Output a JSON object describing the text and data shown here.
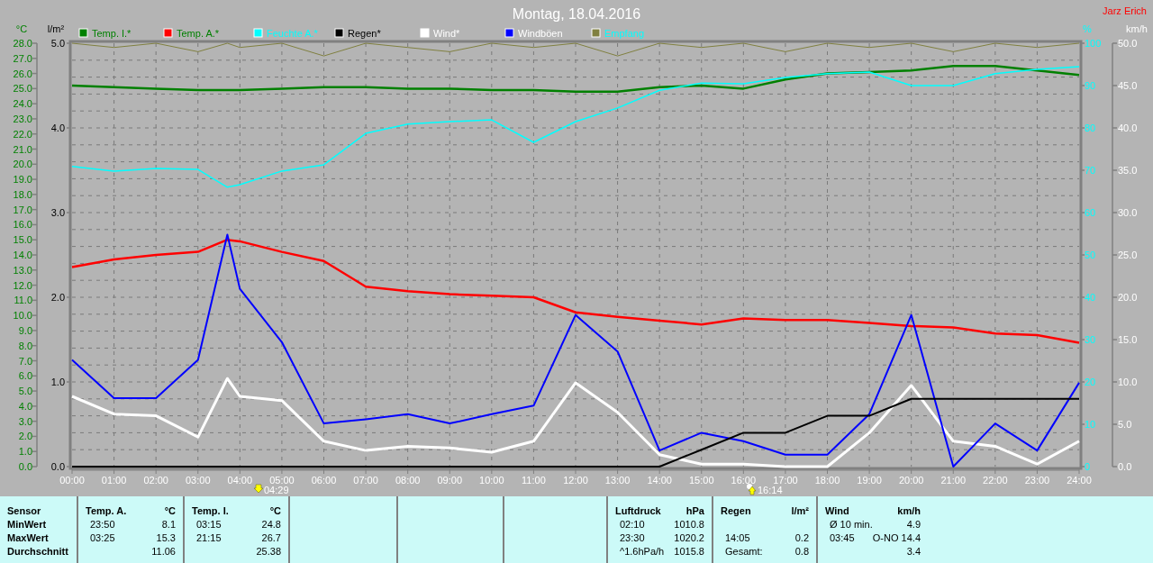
{
  "title": "Montag, 18.04.2016",
  "author": "Jarz Erich",
  "chart": {
    "chart_data": {
      "type": "line",
      "grid": true,
      "legend": "top",
      "ylabel": "°C",
      "y2label": "%",
      "y3label": "km/h",
      "x": [
        0,
        1,
        2,
        3,
        3.7,
        4,
        5,
        6,
        7,
        8,
        9,
        10,
        11,
        12,
        13,
        14,
        15,
        16,
        17,
        18,
        19,
        20,
        21,
        22,
        23,
        24
      ],
      "xlim": [
        0,
        24
      ],
      "xticks": [
        {
          "value": 0,
          "label": "00:00"
        },
        {
          "value": 1,
          "label": "01:00"
        },
        {
          "value": 2,
          "label": "02:00"
        },
        {
          "value": 3,
          "label": "03:00"
        },
        {
          "value": 4,
          "label": "04:00"
        },
        {
          "value": 5,
          "label": "05:00"
        },
        {
          "value": 6,
          "label": "06:00"
        },
        {
          "value": 7,
          "label": "07:00"
        },
        {
          "value": 8,
          "label": "08:00"
        },
        {
          "value": 9,
          "label": "09:00"
        },
        {
          "value": 10,
          "label": "10:00"
        },
        {
          "value": 11,
          "label": "11:00"
        },
        {
          "value": 12,
          "label": "12:00"
        },
        {
          "value": 13,
          "label": "13:00"
        },
        {
          "value": 14,
          "label": "14:00"
        },
        {
          "value": 15,
          "label": "15:00"
        },
        {
          "value": 16,
          "label": "16:00"
        },
        {
          "value": 17,
          "label": "17:00"
        },
        {
          "value": 18,
          "label": "18:00"
        },
        {
          "value": 19,
          "label": "19:00"
        },
        {
          "value": 20,
          "label": "20:00"
        },
        {
          "value": 21,
          "label": "21:00"
        },
        {
          "value": 22,
          "label": "22:00"
        },
        {
          "value": 23,
          "label": "23:00"
        },
        {
          "value": 24,
          "label": "24:00"
        }
      ],
      "ylim": [
        0,
        28
      ],
      "yticks": [
        {
          "value": 28,
          "label": "28.0"
        },
        {
          "value": 27,
          "label": "27.0"
        },
        {
          "value": 26,
          "label": "26.0"
        },
        {
          "value": 25,
          "label": "25.0"
        },
        {
          "value": 24,
          "label": "24.0"
        },
        {
          "value": 23,
          "label": "23.0"
        },
        {
          "value": 22,
          "label": "22.0"
        },
        {
          "value": 21,
          "label": "21.0"
        },
        {
          "value": 20,
          "label": "20.0"
        },
        {
          "value": 19,
          "label": "19.0"
        },
        {
          "value": 18,
          "label": "18.0"
        },
        {
          "value": 17,
          "label": "17.0"
        },
        {
          "value": 16,
          "label": "16.0"
        },
        {
          "value": 15,
          "label": "15.0"
        },
        {
          "value": 14,
          "label": "14.0"
        },
        {
          "value": 13,
          "label": "13.0"
        },
        {
          "value": 12,
          "label": "12.0"
        },
        {
          "value": 11,
          "label": "11.0"
        },
        {
          "value": 10,
          "label": "10.0"
        },
        {
          "value": 9,
          "label": "9.0"
        },
        {
          "value": 8,
          "label": "8.0"
        },
        {
          "value": 7,
          "label": "7.0"
        },
        {
          "value": 6,
          "label": "6.0"
        },
        {
          "value": 5,
          "label": "5.0"
        },
        {
          "value": 4,
          "label": "4.0"
        },
        {
          "value": 3,
          "label": "3.0"
        },
        {
          "value": 2,
          "label": "2.0"
        },
        {
          "value": 1,
          "label": "1.0"
        },
        {
          "value": 0,
          "label": "0.0"
        }
      ],
      "y2lim": [
        0,
        100
      ],
      "y2ticks": [
        {
          "value": 100,
          "label": "100"
        },
        {
          "value": 90,
          "label": "90"
        },
        {
          "value": 80,
          "label": "80"
        },
        {
          "value": 70,
          "label": "70"
        },
        {
          "value": 60,
          "label": "60"
        },
        {
          "value": 50,
          "label": "50"
        },
        {
          "value": 40,
          "label": "40"
        },
        {
          "value": 30,
          "label": "30"
        },
        {
          "value": 20,
          "label": "20"
        },
        {
          "value": 10,
          "label": "10"
        },
        {
          "value": 0,
          "label": "0"
        }
      ],
      "y3lim": [
        0,
        50
      ],
      "y3ticks": [
        {
          "value": 50,
          "label": "50.0"
        },
        {
          "value": 45,
          "label": "45.0"
        },
        {
          "value": 40,
          "label": "40.0"
        },
        {
          "value": 35,
          "label": "35.0"
        },
        {
          "value": 30,
          "label": "30.0"
        },
        {
          "value": 25,
          "label": "25.0"
        },
        {
          "value": 20,
          "label": "20.0"
        },
        {
          "value": 15,
          "label": "15.0"
        },
        {
          "value": 10,
          "label": "10.0"
        },
        {
          "value": 5,
          "label": "5.0"
        },
        {
          "value": 0,
          "label": "0.0"
        }
      ],
      "series": [
        {
          "name": "Temp. I.*",
          "color": "#008000",
          "values": [
            25.2,
            25.1,
            25.0,
            24.9,
            24.9,
            24.9,
            25.0,
            25.1,
            25.1,
            25.0,
            25.0,
            24.9,
            24.9,
            24.8,
            24.8,
            25.1,
            25.2,
            25.0,
            25.6,
            26.0,
            26.1,
            26.2,
            26.5,
            26.5,
            26.2,
            25.9
          ]
        },
        {
          "name": "Temp. A.*",
          "color": "#ff0000",
          "values": [
            13.2,
            13.7,
            14.0,
            14.2,
            15.0,
            14.9,
            14.2,
            13.6,
            11.9,
            11.6,
            11.4,
            11.3,
            11.2,
            10.2,
            9.9,
            9.65,
            9.4,
            9.8,
            9.7,
            9.7,
            9.5,
            9.3,
            9.2,
            8.8,
            8.7,
            8.2
          ]
        },
        {
          "name": "Feuchte A.*",
          "color": "#00ffff",
          "axis": "y2",
          "values": [
            70.9,
            69.8,
            70.4,
            70.2,
            66.0,
            66.6,
            69.8,
            71.3,
            78.7,
            80.9,
            81.5,
            81.9,
            76.6,
            81.5,
            84.7,
            88.9,
            90.6,
            90.4,
            91.9,
            92.8,
            93.2,
            90.0,
            90.0,
            92.8,
            93.8,
            94.5
          ]
        },
        {
          "name": "Wind*",
          "color": "#ffffff",
          "axis": "y3",
          "values": [
            8.3,
            6.2,
            6.0,
            3.5,
            10.4,
            8.3,
            7.8,
            3.0,
            1.9,
            2.4,
            2.2,
            1.7,
            3.0,
            9.9,
            6.4,
            1.4,
            0.3,
            0.3,
            0,
            0,
            4.0,
            9.6,
            3.0,
            2.4,
            0.3,
            3.0
          ]
        },
        {
          "name": "Windböen",
          "color": "#0000ff",
          "axis": "y3",
          "values": [
            12.6,
            8.1,
            8.1,
            12.6,
            27.4,
            21.0,
            14.7,
            5.1,
            5.6,
            6.2,
            5.1,
            6.2,
            7.2,
            17.9,
            13.6,
            1.9,
            4.0,
            3.0,
            1.4,
            1.4,
            6.2,
            17.9,
            0,
            5.1,
            1.9,
            9.9
          ]
        },
        {
          "name": "Empfang",
          "color": "#808040",
          "axis": "y2",
          "values": [
            100,
            99,
            100,
            98,
            100,
            99,
            100,
            97,
            100,
            99,
            98,
            100,
            99,
            100,
            97,
            100,
            99,
            100,
            98,
            100,
            99,
            100,
            98,
            100,
            99,
            100
          ]
        }
      ]
    },
    "sun_events": [
      {
        "kind": "sunrise",
        "label": "04:29"
      },
      {
        "kind": "sunset",
        "label": "16:14"
      }
    ]
  },
  "rain_chart": {
    "chart_data": {
      "type": "line",
      "ylabel": "l/m²",
      "x": [
        0,
        14,
        15,
        16,
        17,
        18,
        19,
        20,
        21,
        22,
        23,
        24
      ],
      "xlim": [
        0,
        24
      ],
      "ylim": [
        0,
        5
      ],
      "yticks": [
        {
          "value": 5,
          "label": "5.0"
        },
        {
          "value": 4,
          "label": "4.0"
        },
        {
          "value": 3,
          "label": "3.0"
        },
        {
          "value": 2,
          "label": "2.0"
        },
        {
          "value": 1,
          "label": "1.0"
        },
        {
          "value": 0,
          "label": "0.0"
        }
      ],
      "series": [
        {
          "name": "Regen*",
          "color": "#000000",
          "values": [
            0,
            0,
            0.2,
            0.4,
            0.4,
            0.6,
            0.6,
            0.8,
            0.8,
            0.8,
            0.8,
            0.8
          ]
        }
      ]
    }
  },
  "sensor_labels": [
    "Sensor",
    "MinWert",
    "MaxWert",
    "Durchschnitt"
  ],
  "panels": [
    {
      "name": "Temp. A.",
      "unit": "°C",
      "rows": [
        {
          "time": "23:50",
          "value": "8.1"
        },
        {
          "time": "03:25",
          "value": "15.3"
        },
        {
          "value": "11.06"
        }
      ]
    },
    {
      "name": "Temp. I.",
      "unit": "°C",
      "rows": [
        {
          "time": "03:15",
          "value": "24.8"
        },
        {
          "time": "21:15",
          "value": "26.7"
        },
        {
          "value": "25.38"
        }
      ]
    },
    {
      "name": "Luftdruck",
      "unit": "hPa",
      "rows": [
        {
          "time": "02:10",
          "value": "1010.8"
        },
        {
          "time": "23:30",
          "value": "1020.2"
        },
        {
          "time": "^1.6hPa/h",
          "value": "1015.8"
        }
      ]
    },
    {
      "name": "Regen",
      "unit": "l/m²",
      "rows": [
        null,
        {
          "time": "14:05",
          "value": "0.2"
        },
        {
          "time": "Gesamt:",
          "value": "0.8"
        }
      ]
    },
    {
      "name": "Wind",
      "unit": "km/h",
      "rows": [
        {
          "time": "Ø 10 min.",
          "value": "4.9"
        },
        {
          "time": "03:45",
          "value": "O-NO 14.4"
        },
        {
          "value": "3.4"
        }
      ]
    }
  ]
}
